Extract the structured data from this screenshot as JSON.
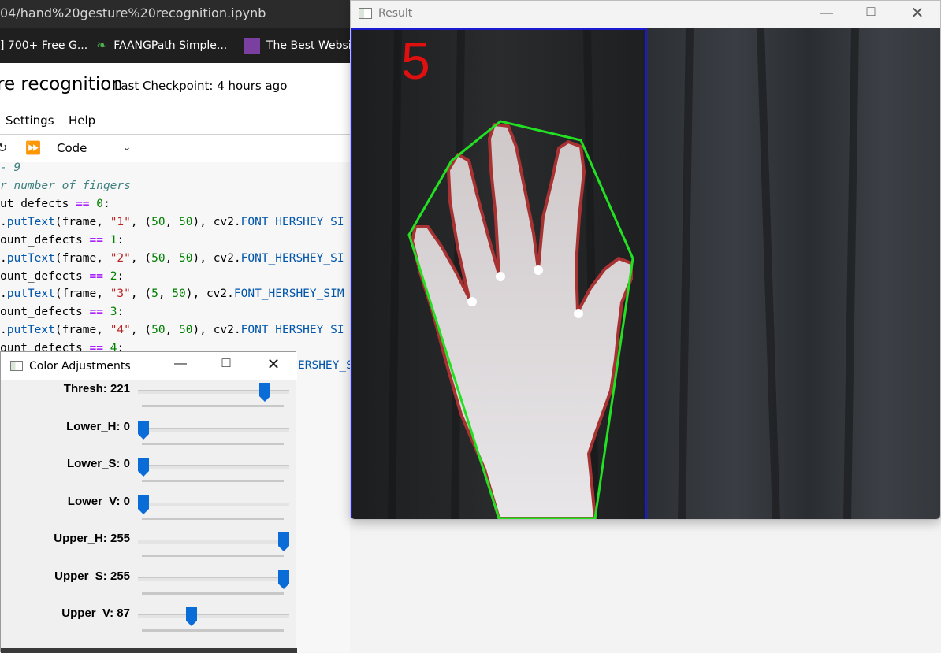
{
  "browser": {
    "url_text": "04/hand%20gesture%20recognition.ipynb",
    "bookmarks": [
      {
        "label": "] 700+ Free G...",
        "icon": "bookmark-icon"
      },
      {
        "label": "FAANGPath Simple...",
        "icon": "leaf-icon"
      },
      {
        "label": "The Best Websit",
        "icon": "purple-tile-icon"
      }
    ]
  },
  "notebook": {
    "title": "re recognition",
    "checkpoint": "Last Checkpoint: 4 hours ago",
    "menu": [
      "Settings",
      "Help"
    ],
    "cell_type": "Code",
    "code_lines": [
      "- 9",
      "r number of fingers",
      "ut_defects == 0:",
      ".putText(frame, \"1\", (50, 50), cv2.FONT_HERSHEY_SI",
      "ount_defects == 1:",
      ".putText(frame, \"2\", (50, 50), cv2.FONT_HERSHEY_SI",
      "ount_defects == 2:",
      ".putText(frame, \"3\", (5, 50), cv2.FONT_HERSHEY_SIM",
      "ount_defects == 3:",
      ".putText(frame, \"4\", (50, 50), cv2.FONT_HERSHEY_SI",
      "ount_defects == 4:",
      "ERSHEY_SI"
    ]
  },
  "color_window": {
    "title": "Color Adjustments",
    "sliders": [
      {
        "label": "Thresh: 221",
        "value": 221,
        "max": 255
      },
      {
        "label": "Lower_H: 0",
        "value": 0,
        "max": 255
      },
      {
        "label": "Lower_S: 0",
        "value": 0,
        "max": 255
      },
      {
        "label": "Lower_V: 0",
        "value": 0,
        "max": 255
      },
      {
        "label": "Upper_H: 255",
        "value": 255,
        "max": 255
      },
      {
        "label": "Upper_S: 255",
        "value": 255,
        "max": 255
      },
      {
        "label": "Upper_V: 87",
        "value": 87,
        "max": 255
      }
    ],
    "thumb_color": "#0a6cd6"
  },
  "result_window": {
    "title": "Result",
    "finger_count": "5",
    "count_color": "#e01010",
    "hull_color": "#22e022",
    "contour_color": "#a83232",
    "roi_color": "#1a1ad0"
  }
}
